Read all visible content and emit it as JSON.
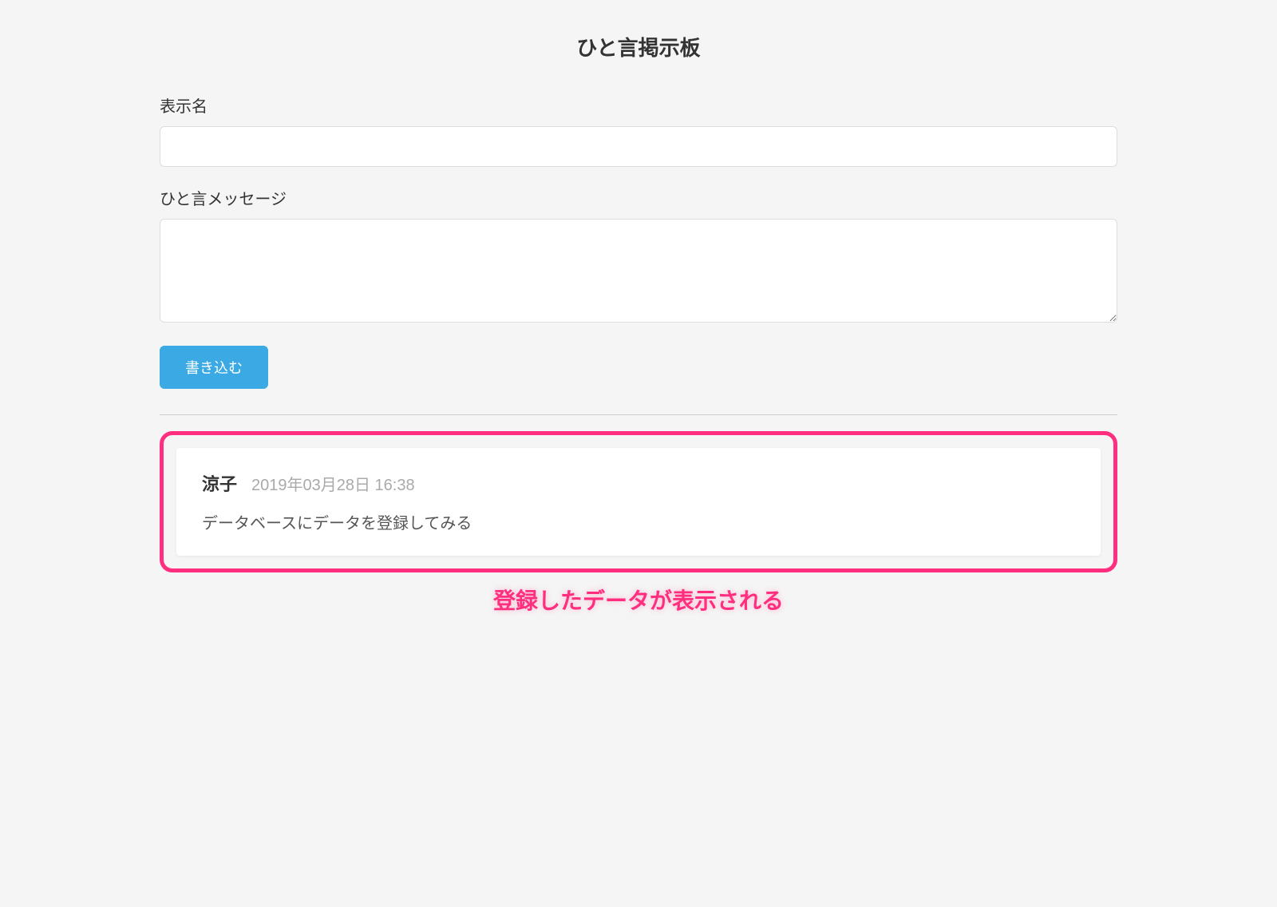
{
  "page": {
    "title": "ひと言掲示板"
  },
  "form": {
    "name_label": "表示名",
    "message_label": "ひと言メッセージ",
    "submit_label": "書き込む"
  },
  "posts": [
    {
      "author": "涼子",
      "timestamp": "2019年03月28日 16:38",
      "message": "データベースにデータを登録してみる"
    }
  ],
  "annotation": {
    "caption": "登録したデータが表示される"
  }
}
